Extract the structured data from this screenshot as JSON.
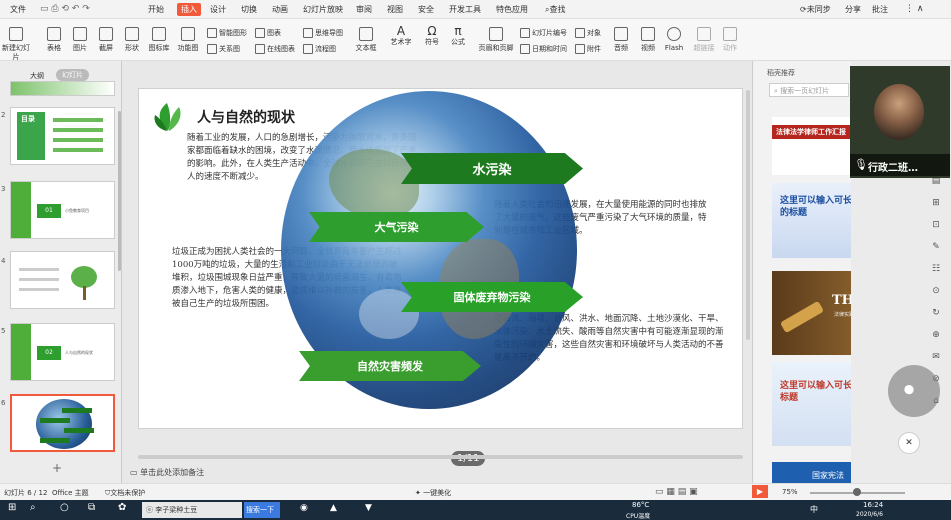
{
  "menubar": {
    "file": "文件",
    "tabs": [
      "开始",
      "插入",
      "设计",
      "切换",
      "动画",
      "幻灯片放映",
      "审阅",
      "视图",
      "安全",
      "开发工具",
      "特色应用"
    ],
    "search": "查找",
    "right": [
      "未同步",
      "分享",
      "批注"
    ]
  },
  "ribbon": {
    "large": [
      "新建幻灯片",
      "表格",
      "图片",
      "截屏",
      "形状",
      "图标库",
      "功能图"
    ],
    "small1": [
      "智能图形",
      "图表"
    ],
    "small2": [
      "关系图",
      "在线图表"
    ],
    "small3": [
      "思维导图",
      "流程图"
    ],
    "large2": [
      "文本框",
      "艺术字",
      "符号",
      "公式",
      "页眉和页脚"
    ],
    "small4": [
      "幻灯片编号",
      "对象"
    ],
    "small5": [
      "日期和时间",
      "附件"
    ],
    "large3": [
      "音频",
      "视频",
      "Flash",
      "超链接",
      "动作"
    ]
  },
  "leftpanel": {
    "tabs": [
      "大纲",
      "幻灯片"
    ],
    "slides": [
      {
        "num": "2",
        "title": "目录"
      },
      {
        "num": "3",
        "title": "01",
        "subtitle": "小鱼教育项目"
      },
      {
        "num": "4",
        "title": ""
      },
      {
        "num": "5",
        "title": "02",
        "subtitle": "人与自然的现状"
      },
      {
        "num": "6",
        "title": ""
      }
    ],
    "add": "+"
  },
  "slide": {
    "title": "人与自然的现状",
    "para1": "随着工业的发展，人口的急剧增长，污染为抽取河水，许多国家都面临着缺水的困境，改变了水流情况，使水体受到了严重的影响。此外，在人类生产活动中，全球水资源已在以日渐惊人的速度不断减少。",
    "para2": "垃圾正成为困扰人类社会的一大问题，全世界每年要产生超过1000万吨的垃圾，大量的生活和工业垃圾由于无法处理而被堆积，垃圾围城现象日益严重，导致大量的病菌滋生，有毒物质渗入地下，危害人类的健康，造成难以补救的损害，人类将被自己生产的垃圾所围困。",
    "para3": "随着人类社会的迅速发展，在大量使用能源的同时也排放了大量的废气，这些废气严重污染了大气环境的质量，特别是在城市和工业区域。",
    "para4": "泥石流、海啸、台风、洪水、地面沉降、土地沙漠化、干旱、水体污染、水土流失、酸雨等自然灾害中有可能逐渐显现的渐变性的环境灾害，这些自然灾害和环境破坏与人类活动的不善是离不开的。",
    "banners": [
      "水污染",
      "大气污染",
      "固体废弃物污染",
      "自然灾害频发"
    ],
    "page": "1/11"
  },
  "notes": "单击此处添加备注",
  "rightpanel": {
    "title": "稻壳推荐",
    "search": "搜索一页幻灯片",
    "cards": [
      {
        "title": "法律法学律师工作汇报"
      },
      {
        "title": "这里可以输入可长可短的标题"
      },
      {
        "title": "THE LAW",
        "sub": "法律实践 律师事务所专用"
      },
      {
        "title": "这里可以输入可长可短的标题"
      },
      {
        "title": "国家宪法"
      }
    ]
  },
  "video": {
    "caption": "行政二班…"
  },
  "status": {
    "slide": "幻灯片 6 / 12",
    "theme": "Office 主题",
    "protect": "文档未保护",
    "beautify": "一键美化",
    "zoom": "75%"
  },
  "taskbar": {
    "app1": "李子梁种土豆",
    "search": "搜索一下",
    "weather": "86°C",
    "weather2": "CPU温度",
    "time": "16:24",
    "date": "2020/6/6",
    "lang": "中"
  },
  "colors": {
    "accent": "#f05a3a",
    "green": "#2e9e2e",
    "darkgreen": "#1e7a1e"
  }
}
